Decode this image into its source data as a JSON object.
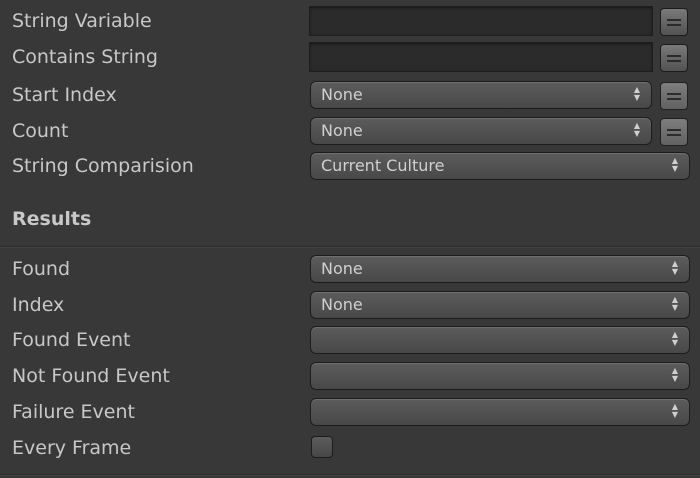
{
  "fields": {
    "string_variable": {
      "label": "String Variable"
    },
    "contains_string": {
      "label": "Contains String"
    },
    "start_index": {
      "label": "Start Index",
      "value": "None"
    },
    "count": {
      "label": "Count",
      "value": "None"
    },
    "string_comparison": {
      "label": "String Comparision",
      "value": "Current Culture"
    }
  },
  "results": {
    "title": "Results",
    "found": {
      "label": "Found",
      "value": "None"
    },
    "index": {
      "label": "Index",
      "value": "None"
    },
    "found_event": {
      "label": "Found Event",
      "value": ""
    },
    "not_found_event": {
      "label": "Not Found Event",
      "value": ""
    },
    "failure_event": {
      "label": "Failure Event",
      "value": ""
    },
    "every_frame": {
      "label": "Every Frame",
      "checked": false
    }
  },
  "icons": {
    "variable_toggle": "equals-icon",
    "select_arrows": "up-down-arrows-icon"
  },
  "colors": {
    "background": "#383838",
    "text": "#c8c8c8"
  }
}
